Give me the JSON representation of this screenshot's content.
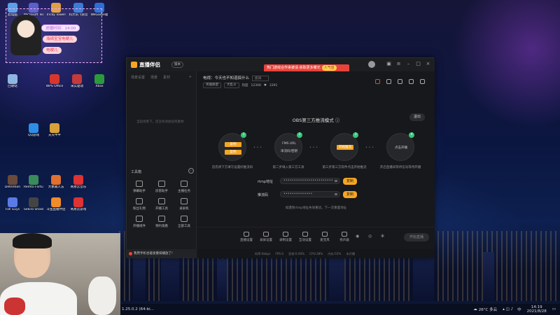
{
  "desktop": {
    "icons": [
      {
        "label": "此电脑",
        "color": "#5aa0e6"
      },
      {
        "label": "Microsoft Teams",
        "color": "#5b5fc7"
      },
      {
        "label": "Tricky Towers",
        "color": "#e0a040"
      },
      {
        "label": "科大讯飞语音",
        "color": "#3a7bd5"
      },
      {
        "label": "WeGame版",
        "color": "#2a6fd8"
      },
      {
        "label": "回收站",
        "color": "#8fb6e0"
      },
      {
        "label": "WPS Office",
        "color": "#d9362b"
      },
      {
        "label": "采实驱动",
        "color": "#c43a3a"
      },
      {
        "label": "Xbox",
        "color": "#2c9a3b"
      },
      {
        "label": "QQ游戏",
        "color": "#2e8de6"
      },
      {
        "label": "天天牛牛",
        "color": "#d8a23a"
      },
      {
        "label": "Detention",
        "color": "#6a4a3a"
      },
      {
        "label": "Remto Fortune",
        "color": "#3a8a5a"
      },
      {
        "label": "大象输入法",
        "color": "#e07030"
      },
      {
        "label": "网易云音乐",
        "color": "#d33"
      },
      {
        "label": "Fall Guys",
        "color": "#5a7ae6"
      },
      {
        "label": "Sekiro Shadows",
        "color": "#444"
      },
      {
        "label": "斗鱼直播伴侣",
        "color": "#f08c2a"
      },
      {
        "label": "网易云游戏",
        "color": "#d33"
      }
    ]
  },
  "widget": {
    "time_label": "进播时间：14:00",
    "chip1": "海绵宝宝电绠儿",
    "chip2": "电绠儿"
  },
  "app": {
    "logo": "直播伴侣",
    "version_label": "版本",
    "promo_text": "热门游戏合作来被请·获取更多曝光",
    "promo_cta": "人气值",
    "sidebar": {
      "tabs": [
        "场景设置",
        "场景",
        "素材"
      ],
      "empty_tip": "当前场景下，还没有添加任何素材",
      "tools_title": "工具箱",
      "tools": [
        "弹幕助手",
        "房管助手",
        "主播任务",
        "粉丝礼物",
        "开播工具",
        "录屏机",
        "开播组件",
        "预约观看",
        "全部工具"
      ],
      "tip_bar": "我用手机也能发重排播放了!"
    },
    "channel": {
      "label": "电视：今天也不知道搞什么",
      "room_box": "房间",
      "category": "英雄联盟",
      "sub": "大乱斗",
      "hot_label": "热度",
      "hot_value": "12306",
      "fans_value": "3391"
    },
    "obs": {
      "title": "OBS第三方推流模式",
      "exit": "退出",
      "steps": [
        {
          "num": "1",
          "caption": "首先将下方填写设置好推流码",
          "tag1": "复制",
          "tag2": "复制"
        },
        {
          "num": "2",
          "caption": "第二步填入第三方工具",
          "line1": "FMS URL",
          "line2": "串流码/密钥"
        },
        {
          "num": "3",
          "caption": "第三步第三方软件点击开始推流",
          "tag": "开始推流"
        },
        {
          "num": "4",
          "caption": "开启直播间等待信号等待开播",
          "line1": "点击开播"
        }
      ],
      "rtmp_label": "rtmp地址",
      "rtmp_value": "••••••••••••••••••••••••",
      "key_label": "推流码",
      "key_value": "••••••••••••••",
      "copy": "复制",
      "hint": "如遇到rtmp地址失效重试，下一次重置地址"
    },
    "bottom_tools": [
      "直播设置",
      "录屏设置",
      "录制设置",
      "互动设置",
      "麦克风",
      "扬声器"
    ],
    "start_button": "开始直播",
    "status": [
      "码率:0kbps",
      "FPS:0",
      "丢帧:0.00%",
      "CPU:28%",
      "内存:55%",
      "未开播"
    ]
  },
  "taskbar": {
    "app_label": "1.25.0.2 (64-bi...",
    "weather": "26°C 多云",
    "lang": "中",
    "time": "14:19",
    "date": "2021/8/28"
  }
}
